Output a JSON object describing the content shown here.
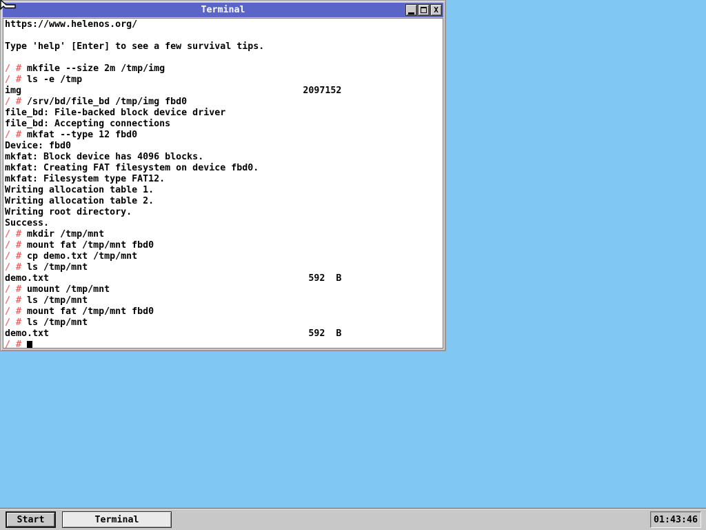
{
  "window": {
    "title": "Terminal",
    "buttons": {
      "minimize": "minimize",
      "maximize": "maximize",
      "close_glyph": "X"
    }
  },
  "terminal": {
    "lines": [
      [
        [
          "n",
          "https://www.helenos.org/"
        ]
      ],
      [],
      [
        [
          "n",
          "Type 'help' [Enter] to see a few survival tips."
        ]
      ],
      [],
      [
        [
          "p",
          "/ # "
        ],
        [
          "n",
          "mkfile --size 2m /tmp/img"
        ]
      ],
      [
        [
          "p",
          "/ # "
        ],
        [
          "n",
          "ls -e /tmp"
        ]
      ],
      [
        [
          "n",
          "img"
        ],
        [
          "s",
          51
        ],
        [
          "n",
          "2097152"
        ]
      ],
      [
        [
          "p",
          "/ # "
        ],
        [
          "n",
          "/srv/bd/file_bd /tmp/img fbd0"
        ]
      ],
      [
        [
          "n",
          "file_bd: File-backed block device driver"
        ]
      ],
      [
        [
          "n",
          "file_bd: Accepting connections"
        ]
      ],
      [
        [
          "p",
          "/ # "
        ],
        [
          "n",
          "mkfat --type 12 fbd0"
        ]
      ],
      [
        [
          "n",
          "Device: fbd0"
        ]
      ],
      [
        [
          "n",
          "mkfat: Block device has 4096 blocks."
        ]
      ],
      [
        [
          "n",
          "mkfat: Creating FAT filesystem on device fbd0."
        ]
      ],
      [
        [
          "n",
          "mkfat: Filesystem type FAT12."
        ]
      ],
      [
        [
          "n",
          "Writing allocation table 1."
        ]
      ],
      [
        [
          "n",
          "Writing allocation table 2."
        ]
      ],
      [
        [
          "n",
          "Writing root directory."
        ]
      ],
      [
        [
          "n",
          "Success."
        ]
      ],
      [
        [
          "p",
          "/ # "
        ],
        [
          "n",
          "mkdir /tmp/mnt"
        ]
      ],
      [
        [
          "p",
          "/ # "
        ],
        [
          "n",
          "mount fat /tmp/mnt fbd0"
        ]
      ],
      [
        [
          "p",
          "/ # "
        ],
        [
          "n",
          "cp demo.txt /tmp/mnt"
        ]
      ],
      [
        [
          "p",
          "/ # "
        ],
        [
          "n",
          "ls /tmp/mnt"
        ]
      ],
      [
        [
          "n",
          "demo.txt"
        ],
        [
          "s",
          47
        ],
        [
          "n",
          "592  B"
        ]
      ],
      [
        [
          "p",
          "/ # "
        ],
        [
          "n",
          "umount /tmp/mnt"
        ]
      ],
      [
        [
          "p",
          "/ # "
        ],
        [
          "n",
          "ls /tmp/mnt"
        ]
      ],
      [
        [
          "p",
          "/ # "
        ],
        [
          "n",
          "mount fat /tmp/mnt fbd0"
        ]
      ],
      [
        [
          "p",
          "/ # "
        ],
        [
          "n",
          "ls /tmp/mnt"
        ]
      ],
      [
        [
          "n",
          "demo.txt"
        ],
        [
          "s",
          47
        ],
        [
          "n",
          "592  B"
        ]
      ],
      [
        [
          "p",
          "/ # "
        ],
        [
          "c"
        ]
      ]
    ]
  },
  "taskbar": {
    "start_label": "Start",
    "task_buttons": [
      {
        "label": "Terminal"
      }
    ],
    "clock": "01:43:46"
  },
  "colors": {
    "desktop": "#80c7f4",
    "titlebar": "#5b65c8",
    "window_frame": "#cdcdcd",
    "terminal_bg": "#ffffff",
    "terminal_fg": "#000000",
    "prompt_red": "#ee6b6b",
    "taskbar_bg": "#c8c8c8",
    "active_task_bg": "#eaeaea"
  }
}
